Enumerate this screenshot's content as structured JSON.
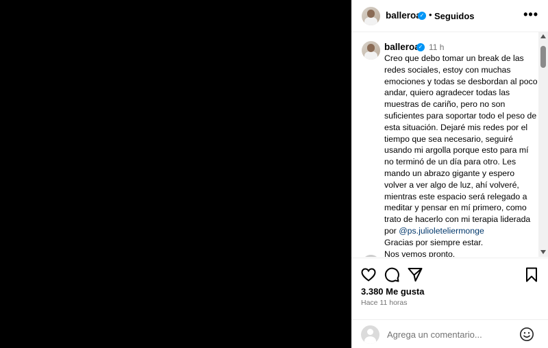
{
  "post": {
    "username": "balleroa",
    "follow_status": "Seguidos",
    "more_icon": "more-options-icon"
  },
  "caption": {
    "username": "balleroa",
    "time": "11 h",
    "text": "Creo que debo tomar un break de las redes sociales, estoy con muchas emociones y todas se desbordan al poco andar, quiero agradecer todas las muestras de cariño, pero no son suficientes para soportar todo el peso de esta situación. Dejaré mis redes por el tiempo que sea necesario, seguiré usando mi argolla porque esto para mí no terminó de un día para otro. Les mando un abrazo gigante y espero volver a ver algo de luz, ahí volveré, mientras este espacio será relegado a meditar y pensar en mí primero, como trato de hacerlo con mi terapia liderada por ",
    "mention": "@ps.julioleteliermonge",
    "line_thanks": "Gracias por siempre estar.",
    "line_bye": "Nos vemos pronto."
  },
  "actions": {
    "likes": "3.380 Me gusta",
    "ago": "Hace 11 horas"
  },
  "comment_box": {
    "placeholder": "Agrega un comentario..."
  },
  "colors": {
    "verified": "#0095f6",
    "mention": "#00376b",
    "muted": "#737373"
  }
}
